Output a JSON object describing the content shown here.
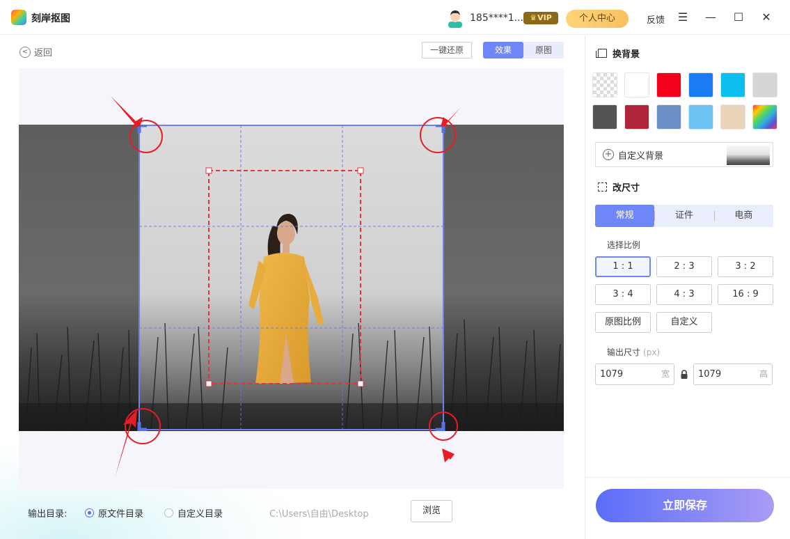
{
  "app": {
    "title": "刻岸抠图"
  },
  "header": {
    "user_name": "185****1...",
    "vip_label": "VIP",
    "personal_center": "个人中心",
    "feedback": "反馈",
    "menu_icon": "menu-icon",
    "minimize_icon": "minimize-icon",
    "maximize_icon": "maximize-icon",
    "close_icon": "close-icon"
  },
  "editor": {
    "back_label": "返回",
    "restore_label": "一键还原",
    "view_tabs": [
      {
        "label": "效果",
        "active": true
      },
      {
        "label": "原图",
        "active": false
      }
    ]
  },
  "output": {
    "label": "输出目录:",
    "option_original": "原文件目录",
    "option_custom": "自定义目录",
    "selected": "原文件目录",
    "path": "C:\\Users\\自由\\Desktop",
    "browse_label": "浏览"
  },
  "background": {
    "title": "换背景",
    "swatches": [
      "transparent",
      "#ffffff",
      "#f5001c",
      "#1a7cf5",
      "#0cbef0",
      "#d6d6d6",
      "#545454",
      "#b0253a",
      "#6b8fc5",
      "#6cc3f3",
      "#ead5bb",
      "rainbow"
    ],
    "custom_label": "自定义背景"
  },
  "resize": {
    "title": "改尺寸",
    "tabs": [
      {
        "label": "常规",
        "active": true
      },
      {
        "label": "证件",
        "active": false
      },
      {
        "label": "电商",
        "active": false
      }
    ],
    "ratio_label": "选择比例",
    "ratios": [
      {
        "label": "1 : 1",
        "active": true
      },
      {
        "label": "2 : 3",
        "active": false
      },
      {
        "label": "3 : 2",
        "active": false
      },
      {
        "label": "3 : 4",
        "active": false
      },
      {
        "label": "4 : 3",
        "active": false
      },
      {
        "label": "16 : 9",
        "active": false
      },
      {
        "label": "原图比例",
        "active": false
      },
      {
        "label": "自定义",
        "active": false
      }
    ],
    "output_size_label": "输出尺寸",
    "output_size_unit": "(px)",
    "width_value": "1079",
    "width_suffix": "宽",
    "height_value": "1079",
    "height_suffix": "高"
  },
  "save_label": "立即保存"
}
